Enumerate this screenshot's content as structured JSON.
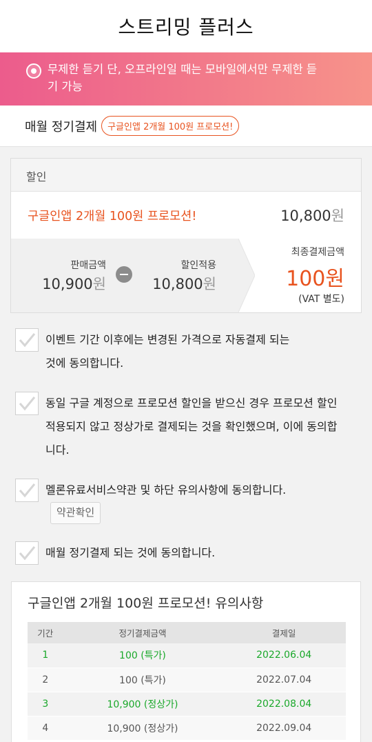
{
  "header": {
    "title": "스트리밍 플러스"
  },
  "notice": {
    "icon": "disc-icon",
    "text": "무제한 듣기 단, 오프라인일 때는 모바일에서만 무제한 듣기 가능"
  },
  "plan": {
    "label": "매월 정기결제",
    "promo_badge": "구글인앱 2개월 100원 프로모션!"
  },
  "discount": {
    "header": "할인",
    "promo_name": "구글인앱 2개월 100원 프로모션!",
    "promo_amount": "10,800",
    "won": "원",
    "sale_label": "판매금액",
    "sale_amount": "10,900",
    "applied_label": "할인적용",
    "applied_amount": "10,800",
    "final_label": "최종결제금액",
    "final_amount": "100원",
    "vat": "(VAT 별도)"
  },
  "agreements": {
    "a1": {
      "line1": "이벤트 기간 이후에는 변경된 가격으로 자동결제 되는",
      "line2": "것에 동의합니다."
    },
    "a2": {
      "line1": "동일 구글 계정으로 프로모션 할인을 받으신 경우 프로모션 할인",
      "line2": "적용되지 않고 정상가로 결제되는 것을 확인했으며, 이에 동의합",
      "line3": "니다."
    },
    "a3": {
      "line1": "멜론유료서비스약관 및 하단 유의사항에 동의합니다.",
      "terms_button": "약관확인"
    },
    "a4": {
      "line1": "매월 정기결제 되는 것에 동의합니다."
    }
  },
  "caution": {
    "title": "구글인앱 2개월 100원 프로모션! 유의사항",
    "headers": {
      "period": "기간",
      "amount": "정기결제금액",
      "date": "결제일"
    },
    "rows": {
      "r1": {
        "period": "1",
        "amount": "100 (특가)",
        "date": "2022.06.04"
      },
      "r2": {
        "period": "2",
        "amount": "100 (특가)",
        "date": "2022.07.04"
      },
      "r3": {
        "period": "3",
        "amount": "10,900 (정상가)",
        "date": "2022.08.04"
      },
      "r4": {
        "period": "4",
        "amount": "10,900 (정상가)",
        "date": "2022.09.04"
      }
    }
  },
  "colors": {
    "accent": "#e8531f",
    "green": "#1aa82a",
    "notice_start": "#ec5c8c",
    "notice_end": "#f7938a"
  }
}
